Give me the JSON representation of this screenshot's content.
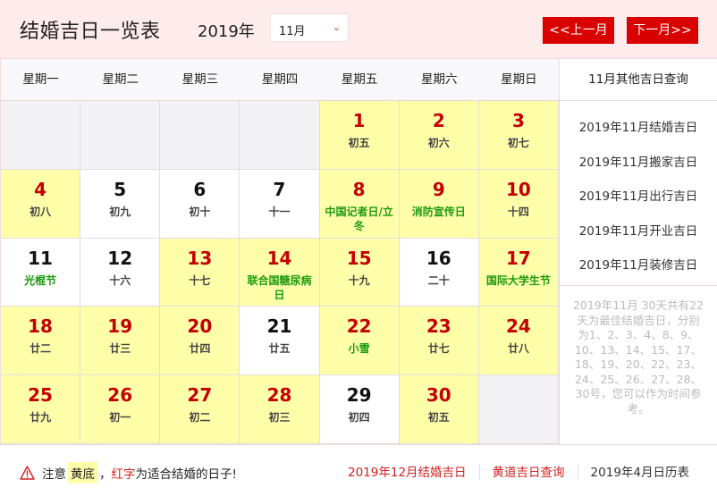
{
  "header": {
    "title": "结婚吉日一览表",
    "year": "2019年",
    "month_selected": "11月",
    "prev_label": "<<上一月",
    "next_label": "下一月>>"
  },
  "weekdays": [
    "星期一",
    "星期二",
    "星期三",
    "星期四",
    "星期五",
    "星期六",
    "星期日"
  ],
  "calendar": {
    "cells": [
      {
        "day": "",
        "lunar": "",
        "type": "empty"
      },
      {
        "day": "",
        "lunar": "",
        "type": "empty"
      },
      {
        "day": "",
        "lunar": "",
        "type": "empty"
      },
      {
        "day": "",
        "lunar": "",
        "type": "empty"
      },
      {
        "day": "1",
        "lunar": "初五",
        "type": "auspicious",
        "festival": false
      },
      {
        "day": "2",
        "lunar": "初六",
        "type": "auspicious",
        "festival": false
      },
      {
        "day": "3",
        "lunar": "初七",
        "type": "auspicious",
        "festival": false
      },
      {
        "day": "4",
        "lunar": "初八",
        "type": "auspicious",
        "festival": false
      },
      {
        "day": "5",
        "lunar": "初九",
        "type": "normal",
        "festival": false
      },
      {
        "day": "6",
        "lunar": "初十",
        "type": "normal",
        "festival": false
      },
      {
        "day": "7",
        "lunar": "十一",
        "type": "normal",
        "festival": false
      },
      {
        "day": "8",
        "lunar": "中国记者日/立冬",
        "type": "auspicious",
        "festival": true
      },
      {
        "day": "9",
        "lunar": "消防宣传日",
        "type": "auspicious",
        "festival": true
      },
      {
        "day": "10",
        "lunar": "十四",
        "type": "auspicious",
        "festival": false
      },
      {
        "day": "11",
        "lunar": "光棍节",
        "type": "normal",
        "festival": true
      },
      {
        "day": "12",
        "lunar": "十六",
        "type": "normal",
        "festival": false
      },
      {
        "day": "13",
        "lunar": "十七",
        "type": "auspicious",
        "festival": false
      },
      {
        "day": "14",
        "lunar": "联合国糖尿病日",
        "type": "auspicious",
        "festival": true
      },
      {
        "day": "15",
        "lunar": "十九",
        "type": "auspicious",
        "festival": false
      },
      {
        "day": "16",
        "lunar": "二十",
        "type": "normal",
        "festival": false
      },
      {
        "day": "17",
        "lunar": "国际大学生节",
        "type": "auspicious",
        "festival": true
      },
      {
        "day": "18",
        "lunar": "廿二",
        "type": "auspicious",
        "festival": false
      },
      {
        "day": "19",
        "lunar": "廿三",
        "type": "auspicious",
        "festival": false
      },
      {
        "day": "20",
        "lunar": "廿四",
        "type": "auspicious",
        "festival": false
      },
      {
        "day": "21",
        "lunar": "廿五",
        "type": "normal",
        "festival": false
      },
      {
        "day": "22",
        "lunar": "小雪",
        "type": "auspicious",
        "festival": true
      },
      {
        "day": "23",
        "lunar": "廿七",
        "type": "auspicious",
        "festival": false
      },
      {
        "day": "24",
        "lunar": "廿八",
        "type": "auspicious",
        "festival": false
      },
      {
        "day": "25",
        "lunar": "廿九",
        "type": "auspicious",
        "festival": false
      },
      {
        "day": "26",
        "lunar": "初一",
        "type": "auspicious",
        "festival": false
      },
      {
        "day": "27",
        "lunar": "初二",
        "type": "auspicious",
        "festival": false
      },
      {
        "day": "28",
        "lunar": "初三",
        "type": "auspicious",
        "festival": false
      },
      {
        "day": "29",
        "lunar": "初四",
        "type": "normal",
        "festival": false
      },
      {
        "day": "30",
        "lunar": "初五",
        "type": "auspicious",
        "festival": false
      },
      {
        "day": "",
        "lunar": "",
        "type": "empty"
      }
    ]
  },
  "sidebar": {
    "heading": "11月其他吉日查询",
    "links": [
      "2019年11月结婚吉日",
      "2019年11月搬家吉日",
      "2019年11月出行吉日",
      "2019年11月开业吉日",
      "2019年11月装修吉日"
    ],
    "note": "2019年11月 30天共有22天为最佳结婚吉日，分别为1、2、3、4、8、9、10、13、14、15、17、18、19、20、22、23、24、25、26、27、28、30号，您可以作为时间参考。"
  },
  "footer": {
    "notice_prefix": "注意",
    "notice_yellow": "黄底",
    "notice_comma": "，",
    "notice_red": "红字",
    "notice_suffix": "为适合结婚的日子!",
    "links": [
      {
        "label": "2019年12月结婚吉日",
        "color": "#d42020"
      },
      {
        "label": "黄道吉日查询",
        "color": "#d42020"
      },
      {
        "label": "2019年4月日历表",
        "color": "#333333"
      }
    ]
  },
  "colors": {
    "accent_red": "#d90000",
    "auspicious_bg": "#ffffaa",
    "festival_green": "#1e9a10",
    "day_red": "#c40000"
  }
}
